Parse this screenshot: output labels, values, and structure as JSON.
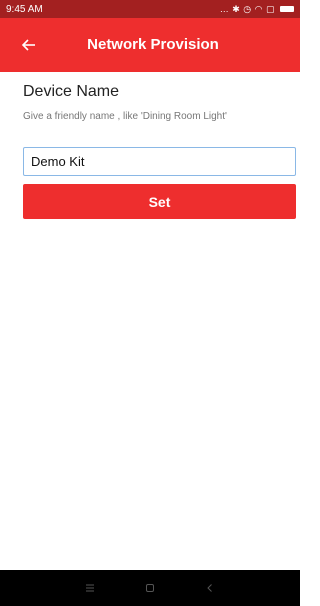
{
  "status_bar": {
    "time": "9:45 AM",
    "icons": [
      "dots-icon",
      "bluetooth-icon",
      "alarm-icon",
      "wifi-icon",
      "sim-icon",
      "battery-icon"
    ]
  },
  "app_bar": {
    "title": "Network Provision",
    "back_icon": "arrow-left-icon"
  },
  "form": {
    "heading": "Device Name",
    "helper": "Give a friendly name , like 'Dining Room Light'",
    "device_name_value": "Demo Kit",
    "set_label": "Set"
  },
  "nav_bar": {
    "icons": [
      "menu-icon",
      "home-icon",
      "back-icon"
    ]
  },
  "colors": {
    "accent": "#ee2e2e",
    "status_bar": "#a32020",
    "input_border": "#8ab8e6"
  }
}
